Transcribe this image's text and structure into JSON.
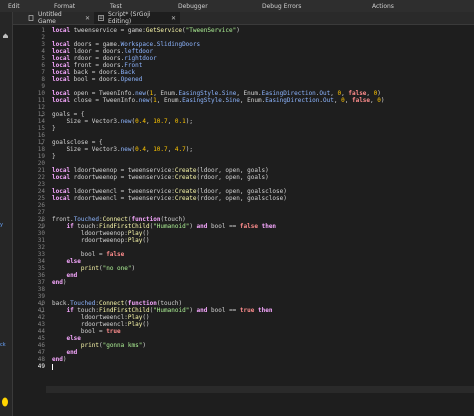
{
  "menu": {
    "items": [
      "Edit",
      "Format",
      "Test",
      "Debugger",
      "Debug Errors",
      "Actions"
    ]
  },
  "tabs": [
    {
      "label": "Untitled Game",
      "close": "✕",
      "active": false
    },
    {
      "label": "Script* (SrGoji Editing)",
      "close": "✕",
      "active": true
    }
  ],
  "left_panel": {
    "labels": [
      "y",
      "ck"
    ]
  },
  "editor": {
    "current_line": 49,
    "line_numbers": [
      1,
      2,
      3,
      4,
      5,
      6,
      7,
      8,
      9,
      10,
      11,
      12,
      13,
      14,
      15,
      16,
      17,
      18,
      19,
      20,
      21,
      22,
      23,
      24,
      25,
      26,
      27,
      28,
      29,
      30,
      31,
      32,
      33,
      34,
      35,
      36,
      37,
      38,
      39,
      40,
      41,
      42,
      43,
      44,
      45,
      46,
      47,
      48,
      49
    ],
    "lines": [
      "local tweenservice = game:GetService(\"TweenService\")",
      "",
      "local doors = game.Workspace.SlidingDoors",
      "local ldoor = doors.leftdoor",
      "local rdoor = doors.rightdoor",
      "local front = doors.Front",
      "local back = doors.Back",
      "local bool = doors.Opened",
      "",
      "local open = TweenInfo.new(1, Enum.EasingStyle.Sine, Enum.EasingDirection.Out, 0, false, 0)",
      "local close = TweenInfo.new(1, Enum.EasingStyle.Sine, Enum.EasingDirection.Out, 0, false, 0)",
      "",
      "goals = {",
      "    Size = Vector3.new(0.4, 10.7, 0.1);",
      "}",
      "",
      "goalsclose = {",
      "    Size = Vector3.new(0.4, 10.7, 4.7);",
      "}",
      "",
      "local ldoortweenop = tweenservice:Create(ldoor, open, goals)",
      "local rdoortweenop = tweenservice:Create(rdoor, open, goals)",
      "",
      "local ldoortweencl = tweenservice:Create(ldoor, open, goalsclose)",
      "local rdoortweencl = tweenservice:Create(rdoor, open, goalsclose)",
      "",
      "",
      "front.Touched:Connect(function(touch)",
      "    if touch:FindFirstChild(\"Humanoid\") and bool == false then",
      "        ldoortweenop:Play()",
      "        rdoortweenop:Play()",
      "",
      "        bool = false",
      "    else",
      "        print(\"no one\")",
      "    end",
      "end)",
      "",
      "",
      "back.Touched:Connect(function(touch)",
      "    if touch:FindFirstChild(\"Humanoid\") and bool == true then",
      "        ldoortweencl:Play()",
      "        rdoortweencl:Play()",
      "        bool = true",
      "    else",
      "        print(\"gonna kms\")",
      "    end",
      "end)",
      ""
    ],
    "fold_markers": {
      "13": "⌄",
      "17": "⌄",
      "28": "⌄",
      "29": "⌄",
      "40": "⌄",
      "41": "⌄"
    }
  },
  "colors": {
    "background": "#1e1e1e",
    "keyword": "#f7a8ff",
    "string": "#adf195",
    "number": "#ffc600",
    "property": "#8db5ff",
    "function": "#fdfbac",
    "boolean": "#ff8d8d"
  }
}
